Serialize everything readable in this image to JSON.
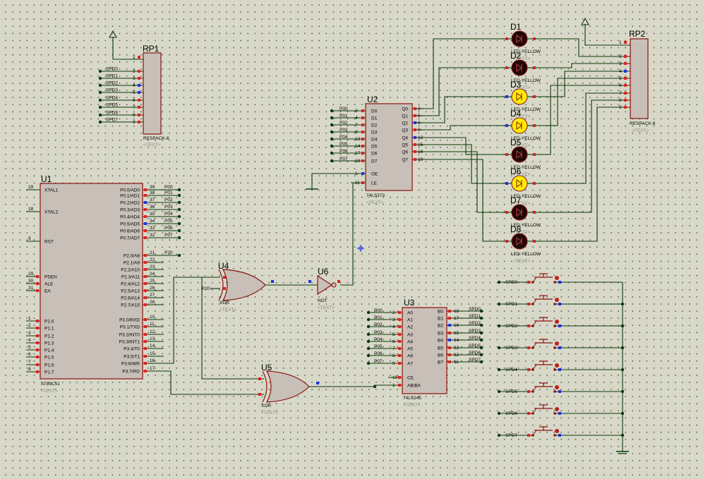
{
  "components": {
    "u1": {
      "ref": "U1",
      "part": "AT89C51",
      "text": "<TEXT>",
      "left_pins": [
        {
          "num": "19",
          "name": "XTAL1"
        },
        {
          "num": "18",
          "name": "XTAL2"
        },
        {
          "num": "9",
          "name": "RST"
        },
        {
          "num": "29",
          "name": "PSEN"
        },
        {
          "num": "30",
          "name": "ALE"
        },
        {
          "num": "31",
          "name": "EA"
        },
        {
          "num": "1",
          "name": "P1.0"
        },
        {
          "num": "2",
          "name": "P1.1"
        },
        {
          "num": "3",
          "name": "P1.2"
        },
        {
          "num": "4",
          "name": "P1.3"
        },
        {
          "num": "5",
          "name": "P1.4"
        },
        {
          "num": "6",
          "name": "P1.5"
        },
        {
          "num": "7",
          "name": "P1.6"
        },
        {
          "num": "8",
          "name": "P1.7"
        }
      ],
      "right_pins": [
        {
          "num": "39",
          "name": "P0.0/AD0",
          "net": "P00"
        },
        {
          "num": "38",
          "name": "P0.1/AD1",
          "net": "P01"
        },
        {
          "num": "37",
          "name": "P0.2/AD2",
          "net": "P02"
        },
        {
          "num": "36",
          "name": "P0.3/AD3",
          "net": "P03"
        },
        {
          "num": "35",
          "name": "P0.4/AD4",
          "net": "P04"
        },
        {
          "num": "34",
          "name": "P0.5/AD5",
          "net": "P05"
        },
        {
          "num": "33",
          "name": "P0.6/AD6",
          "net": "P06"
        },
        {
          "num": "32",
          "name": "P0.7/AD7",
          "net": "P07"
        },
        {
          "num": "21",
          "name": "P2.0/A8",
          "net": "P20"
        },
        {
          "num": "22",
          "name": "P2.1/A9",
          "net": ""
        },
        {
          "num": "23",
          "name": "P2.2/A10",
          "net": ""
        },
        {
          "num": "24",
          "name": "P2.3/A11",
          "net": ""
        },
        {
          "num": "25",
          "name": "P2.4/A12",
          "net": ""
        },
        {
          "num": "26",
          "name": "P2.5/A13",
          "net": ""
        },
        {
          "num": "27",
          "name": "P2.6/A14",
          "net": ""
        },
        {
          "num": "28",
          "name": "P2.7/A15",
          "net": ""
        },
        {
          "num": "10",
          "name": "P3.0/RXD",
          "net": ""
        },
        {
          "num": "11",
          "name": "P3.1/TXD",
          "net": ""
        },
        {
          "num": "12",
          "name": "P3.2/INT0",
          "net": ""
        },
        {
          "num": "13",
          "name": "P3.3/INT1",
          "net": ""
        },
        {
          "num": "14",
          "name": "P3.4/T0",
          "net": ""
        },
        {
          "num": "15",
          "name": "P3.5/T1",
          "net": ""
        },
        {
          "num": "16",
          "name": "P3.6/WR",
          "net": ""
        },
        {
          "num": "17",
          "name": "P3.7/RD",
          "net": ""
        }
      ]
    },
    "rp1": {
      "ref": "RP1",
      "part": "RESPACK-8",
      "text": "<TEXT>",
      "pins": [
        {
          "num": "1",
          "net": ""
        },
        {
          "num": "2",
          "net": "SPD0"
        },
        {
          "num": "3",
          "net": "SPD1"
        },
        {
          "num": "4",
          "net": "SPD2"
        },
        {
          "num": "5",
          "net": "SPD3"
        },
        {
          "num": "6",
          "net": "SPD4"
        },
        {
          "num": "7",
          "net": "SPD5"
        },
        {
          "num": "8",
          "net": "SPD6"
        },
        {
          "num": "9",
          "net": "SPD7"
        }
      ]
    },
    "u2": {
      "ref": "U2",
      "part": "74LS373",
      "text": "<TEXT>",
      "left_pins": [
        {
          "num": "3",
          "name": "D0",
          "net": "P00"
        },
        {
          "num": "4",
          "name": "D1",
          "net": "P01"
        },
        {
          "num": "7",
          "name": "D2",
          "net": "P02"
        },
        {
          "num": "8",
          "name": "D3",
          "net": "P03"
        },
        {
          "num": "13",
          "name": "D4",
          "net": "P04"
        },
        {
          "num": "14",
          "name": "D5",
          "net": "P05"
        },
        {
          "num": "17",
          "name": "D6",
          "net": "P06"
        },
        {
          "num": "18",
          "name": "D7",
          "net": "P07"
        },
        {
          "num": "1",
          "name": "OE",
          "net": ""
        },
        {
          "num": "11",
          "name": "LE",
          "net": ""
        }
      ],
      "right_pins": [
        {
          "num": "2",
          "name": "Q0"
        },
        {
          "num": "5",
          "name": "Q1"
        },
        {
          "num": "6",
          "name": "Q2"
        },
        {
          "num": "9",
          "name": "Q3"
        },
        {
          "num": "12",
          "name": "Q4"
        },
        {
          "num": "15",
          "name": "Q5"
        },
        {
          "num": "16",
          "name": "Q6"
        },
        {
          "num": "19",
          "name": "Q7"
        }
      ]
    },
    "u3": {
      "ref": "U3",
      "part": "74LS245",
      "text": "<TEXT>",
      "left_pins": [
        {
          "num": "2",
          "name": "A0",
          "net": "P00"
        },
        {
          "num": "3",
          "name": "A1",
          "net": "P01"
        },
        {
          "num": "4",
          "name": "A2",
          "net": "P02"
        },
        {
          "num": "5",
          "name": "A3",
          "net": "P03"
        },
        {
          "num": "6",
          "name": "A4",
          "net": "P04"
        },
        {
          "num": "7",
          "name": "A5",
          "net": "P05"
        },
        {
          "num": "8",
          "name": "A6",
          "net": "P06"
        },
        {
          "num": "9",
          "name": "A7",
          "net": "P07"
        },
        {
          "num": "19",
          "name": "CE"
        },
        {
          "num": "1",
          "name": "AB/BA"
        }
      ],
      "right_pins": [
        {
          "num": "18",
          "name": "B0",
          "net": "SPD0"
        },
        {
          "num": "17",
          "name": "B1",
          "net": "SPD1"
        },
        {
          "num": "16",
          "name": "B2",
          "net": "SPD2"
        },
        {
          "num": "15",
          "name": "B3",
          "net": "SPD3"
        },
        {
          "num": "14",
          "name": "B4",
          "net": "SPD4"
        },
        {
          "num": "13",
          "name": "B5",
          "net": "SPD5"
        },
        {
          "num": "12",
          "name": "B6",
          "net": "SPD6"
        },
        {
          "num": "11",
          "name": "B7",
          "net": "SPD7"
        }
      ]
    },
    "u4": {
      "ref": "U4",
      "part": "XOR",
      "text": "<TEXT>",
      "input_net": "P20"
    },
    "u5": {
      "ref": "U5",
      "part": "XOR",
      "text": "<TEXT>"
    },
    "u6": {
      "ref": "U6",
      "part": "NOT",
      "text": "<TEXT>"
    },
    "leds": [
      {
        "ref": "D1",
        "part": "LED-YELLOW",
        "text": "<TEXT>",
        "lit": false
      },
      {
        "ref": "D2",
        "part": "LED-YELLOW",
        "text": "<TEXT>",
        "lit": false
      },
      {
        "ref": "D3",
        "part": "LED-YELLOW",
        "text": "<TEXT>",
        "lit": true
      },
      {
        "ref": "D4",
        "part": "LED-YELLOW",
        "text": "<TEXT>",
        "lit": true
      },
      {
        "ref": "D5",
        "part": "LED-YELLOW",
        "text": "<TEXT>",
        "lit": false
      },
      {
        "ref": "D6",
        "part": "LED-YELLOW",
        "text": "<TEXT>",
        "lit": true
      },
      {
        "ref": "D7",
        "part": "LED-YELLOW",
        "text": "<TEXT>",
        "lit": false
      },
      {
        "ref": "D8",
        "part": "LED-YELLOW",
        "text": "<TEXT>",
        "lit": false
      }
    ],
    "rp2": {
      "ref": "RP2",
      "part": "RESPACK-8",
      "text": "<TEXT>",
      "pins": [
        "1",
        "2",
        "3",
        "4",
        "5",
        "6",
        "7",
        "8",
        "9"
      ]
    },
    "switches": [
      "SPD0",
      "SPD1",
      "SPD2",
      "SPD3",
      "SPD4",
      "SPD5",
      "SPD6",
      "SPD7"
    ]
  },
  "colors": {
    "body": "#c8c0b8",
    "outline": "#8a1010",
    "wire": "#0a3a0a",
    "pin_red": "#e02020",
    "pin_blue": "#2030e0",
    "led_on": "#ffee00",
    "led_off": "#200808"
  }
}
